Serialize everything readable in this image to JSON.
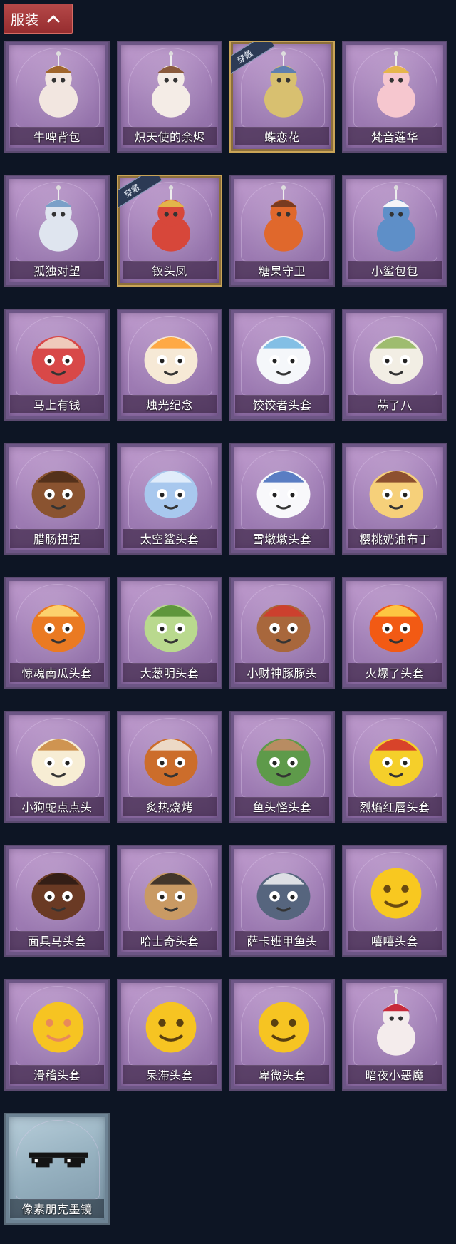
{
  "header": {
    "title": "服装",
    "toggle_icon": "chevron-up-icon"
  },
  "equipped_badge": "穿戴",
  "items": [
    {
      "label": "牛啤背包",
      "icon": "cow-barrel-backpack-icon",
      "color": "#f2e6e0",
      "accent": "#a0652b"
    },
    {
      "label": "炽天使的余烬",
      "icon": "angel-doll-icon",
      "color": "#f4ece6",
      "accent": "#8a5a3c"
    },
    {
      "label": "蝶恋花",
      "icon": "butterfly-bell-charm-icon",
      "color": "#d8c070",
      "accent": "#5d7fb0",
      "equipped": true
    },
    {
      "label": "梵音莲华",
      "icon": "lotus-doll-icon",
      "color": "#f6c7cf",
      "accent": "#e6b64c"
    },
    {
      "label": "孤独对望",
      "icon": "white-hair-doll-icon",
      "color": "#dfe5ef",
      "accent": "#7aa0c8"
    },
    {
      "label": "钗头凤",
      "icon": "phoenix-crown-doll-icon",
      "color": "#d7473a",
      "accent": "#e3b54a",
      "equipped": true
    },
    {
      "label": "糖果守卫",
      "icon": "pumpkin-guard-charm-icon",
      "color": "#e0682c",
      "accent": "#7a3b20"
    },
    {
      "label": "小鲨包包",
      "icon": "little-shark-bag-icon",
      "color": "#5e8fc8",
      "accent": "#f4f4f8"
    },
    {
      "label": "马上有钱",
      "icon": "red-horse-head-icon",
      "color": "#d84848",
      "accent": "#f3e2d0"
    },
    {
      "label": "烛光纪念",
      "icon": "candle-head-icon",
      "color": "#f6e9d6",
      "accent": "#ff9e2c"
    },
    {
      "label": "饺饺者头套",
      "icon": "dumpling-cloud-head-icon",
      "color": "#f5f7fa",
      "accent": "#6fb5e0"
    },
    {
      "label": "蒜了八",
      "icon": "garlic-head-icon",
      "color": "#f2eee4",
      "accent": "#8fb35a"
    },
    {
      "label": "腊肠扭扭",
      "icon": "dachshund-head-icon",
      "color": "#8a5330",
      "accent": "#4a2b18"
    },
    {
      "label": "太空鲨头套",
      "icon": "space-shark-head-icon",
      "color": "#a8c8ee",
      "accent": "#eaf2fb"
    },
    {
      "label": "雪墩墩头套",
      "icon": "snowman-head-icon",
      "color": "#f8f8fb",
      "accent": "#3e67b8"
    },
    {
      "label": "樱桃奶油布丁",
      "icon": "pudding-head-icon",
      "color": "#f6d07a",
      "accent": "#7a3a22"
    },
    {
      "label": "惊魂南瓜头套",
      "icon": "jack-o-lantern-head-icon",
      "color": "#ea7a22",
      "accent": "#ffe07a"
    },
    {
      "label": "大葱明头套",
      "icon": "green-onion-head-icon",
      "color": "#b9d98e",
      "accent": "#4f8a2e"
    },
    {
      "label": "小财神豚豚头",
      "icon": "capybara-god-head-icon",
      "color": "#a8673c",
      "accent": "#d23a2c"
    },
    {
      "label": "火爆了头套",
      "icon": "fire-spirit-head-icon",
      "color": "#f25a14",
      "accent": "#ffd84a"
    },
    {
      "label": "小狗蛇点点头",
      "icon": "dog-snake-head-icon",
      "color": "#f7edd4",
      "accent": "#c8843a"
    },
    {
      "label": "炙热烧烤",
      "icon": "grilled-meat-head-icon",
      "color": "#cc6d2b",
      "accent": "#f1ece2"
    },
    {
      "label": "鱼头怪头套",
      "icon": "fish-monster-head-icon",
      "color": "#5e9a4a",
      "accent": "#c88a66"
    },
    {
      "label": "烈焰红唇头套",
      "icon": "yellow-mouse-sunglasses-head-icon",
      "color": "#f5cf2a",
      "accent": "#d22a2a"
    },
    {
      "label": "面具马头套",
      "icon": "horse-mask-head-icon",
      "color": "#6a3a24",
      "accent": "#2a1a14"
    },
    {
      "label": "哈士奇头套",
      "icon": "husky-sunglasses-head-icon",
      "color": "#c99a64",
      "accent": "#2b2420"
    },
    {
      "label": "萨卡班甲鱼头",
      "icon": "sacabambaspis-head-icon",
      "color": "#56657e",
      "accent": "#f4f4f6"
    },
    {
      "label": "嘻嘻头套",
      "icon": "grin-emoji-head-icon",
      "color": "#f8c820",
      "accent": "#6a4a10"
    },
    {
      "label": "滑稽头套",
      "icon": "funny-emoji-head-icon",
      "color": "#f6c422",
      "accent": "#e88a5a"
    },
    {
      "label": "呆滞头套",
      "icon": "dazed-emoji-head-icon",
      "color": "#f6c422",
      "accent": "#5a4010"
    },
    {
      "label": "卑微头套",
      "icon": "humble-emoji-head-icon",
      "color": "#f6c422",
      "accent": "#5a4010"
    },
    {
      "label": "暗夜小恶魔",
      "icon": "little-devil-icon",
      "color": "#f4ecec",
      "accent": "#c82a3a"
    },
    {
      "label": "像素朋克墨镜",
      "icon": "pixel-sunglasses-icon",
      "color": "#141414",
      "accent": "#ffffff",
      "special": true
    }
  ]
}
